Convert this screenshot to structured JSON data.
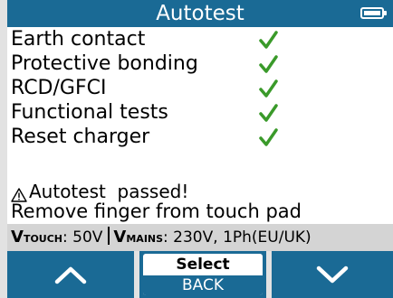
{
  "header": {
    "title": "Autotest",
    "battery_icon": "battery-full-icon"
  },
  "tests": [
    {
      "label": "Earth contact",
      "status": "pass"
    },
    {
      "label": "Protective bonding",
      "status": "pass"
    },
    {
      "label": "RCD/GFCI",
      "status": "pass"
    },
    {
      "label": "Functional tests",
      "status": "pass"
    },
    {
      "label": "Reset charger",
      "status": "pass"
    }
  ],
  "message": {
    "icon": "warning-icon",
    "line1": "Autotest  passed!",
    "line2": "Remove finger from touch pad"
  },
  "status": {
    "touch_main": "V",
    "touch_sub": "TOUCH",
    "touch_value": ": 50V",
    "mains_main": "V",
    "mains_sub": "MAINS",
    "mains_value": ": 230V, 1Ph(EU/UK)"
  },
  "softkeys": {
    "left_icon": "chevron-up-icon",
    "select_label": "Select",
    "back_label": "BACK",
    "right_icon": "chevron-down-icon"
  },
  "colors": {
    "accent": "#1a6a95",
    "check": "#3a9a2a",
    "status_bg": "#d4d4d4"
  }
}
